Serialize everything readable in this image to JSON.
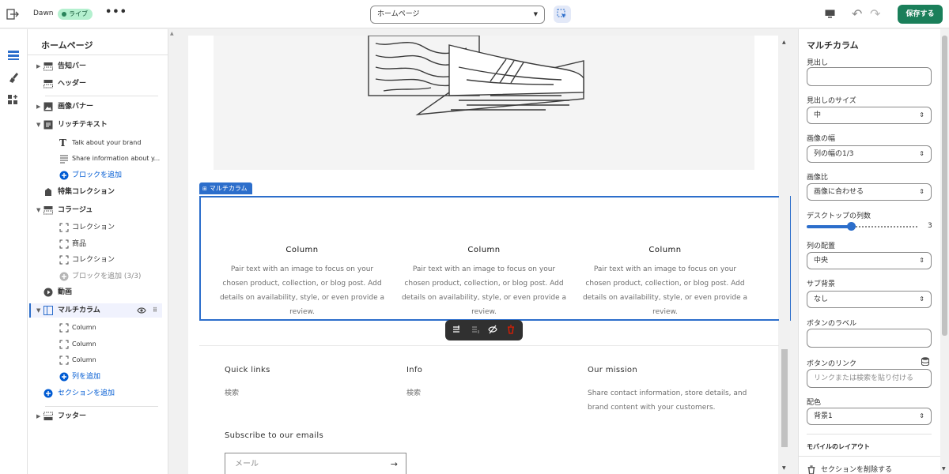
{
  "topbar": {
    "theme_name": "Dawn",
    "live_badge": "ライブ",
    "more": "•••",
    "page_select": "ホームページ",
    "save_label": "保存する"
  },
  "left_panel": {
    "title": "ホームページ",
    "items": [
      {
        "label": "告知バー"
      },
      {
        "label": "ヘッダー"
      },
      {
        "label": "画像バナー"
      },
      {
        "label": "リッチテキスト"
      },
      {
        "label": "Talk about your brand"
      },
      {
        "label": "Share information about y..."
      },
      {
        "label": "ブロックを追加"
      },
      {
        "label": "特集コレクション"
      },
      {
        "label": "コラージュ"
      },
      {
        "label": "コレクション"
      },
      {
        "label": "商品"
      },
      {
        "label": "コレクション"
      },
      {
        "label": "ブロックを追加 (3/3)"
      },
      {
        "label": "動画"
      },
      {
        "label": "マルチカラム"
      },
      {
        "label": "Column"
      },
      {
        "label": "Column"
      },
      {
        "label": "Column"
      },
      {
        "label": "列を追加"
      },
      {
        "label": "セクションを追加"
      },
      {
        "label": "フッター"
      }
    ]
  },
  "preview": {
    "section_tag": "マルチカラム",
    "columns": [
      {
        "heading": "Column",
        "text": "Pair text with an image to focus on your chosen product, collection, or blog post. Add details on availability, style, or even provide a review."
      },
      {
        "heading": "Column",
        "text": "Pair text with an image to focus on your chosen product, collection, or blog post. Add details on availability, style, or even provide a review."
      },
      {
        "heading": "Column",
        "text": "Pair text with an image to focus on your chosen product, collection, or blog post. Add details on availability, style, or even provide a review."
      }
    ],
    "footer": {
      "quick_links_heading": "Quick links",
      "quick_links_item": "検索",
      "info_heading": "Info",
      "info_item": "検索",
      "mission_heading": "Our mission",
      "mission_text": "Share contact information, store details, and brand content with your customers.",
      "subscribe_heading": "Subscribe to our emails",
      "email_placeholder": "メール",
      "email_arrow": "→"
    }
  },
  "right_panel": {
    "title": "マルチカラム",
    "heading_label": "見出し",
    "heading_value": "",
    "heading_size_label": "見出しのサイズ",
    "heading_size_value": "中",
    "image_width_label": "画像の幅",
    "image_width_value": "列の幅の1/3",
    "image_ratio_label": "画像比",
    "image_ratio_value": "画像に合わせる",
    "desktop_columns_label": "デスクトップの列数",
    "desktop_columns_value": "3",
    "desktop_columns_fraction": 0.4,
    "column_align_label": "列の配置",
    "column_align_value": "中央",
    "sub_background_label": "サブ背景",
    "sub_background_value": "なし",
    "button_label_label": "ボタンのラベル",
    "button_label_value": "",
    "button_link_label": "ボタンのリンク",
    "button_link_placeholder": "リンクまたは検索を貼り付ける",
    "color_scheme_label": "配色",
    "color_scheme_value": "背景1",
    "mobile_layout_label": "モバイルのレイアウト",
    "delete_section": "セクションを削除する"
  },
  "colors": {
    "accent": "#2c6ecb",
    "save": "#1a7f5a",
    "live_badge_bg": "#b4f0cf"
  }
}
